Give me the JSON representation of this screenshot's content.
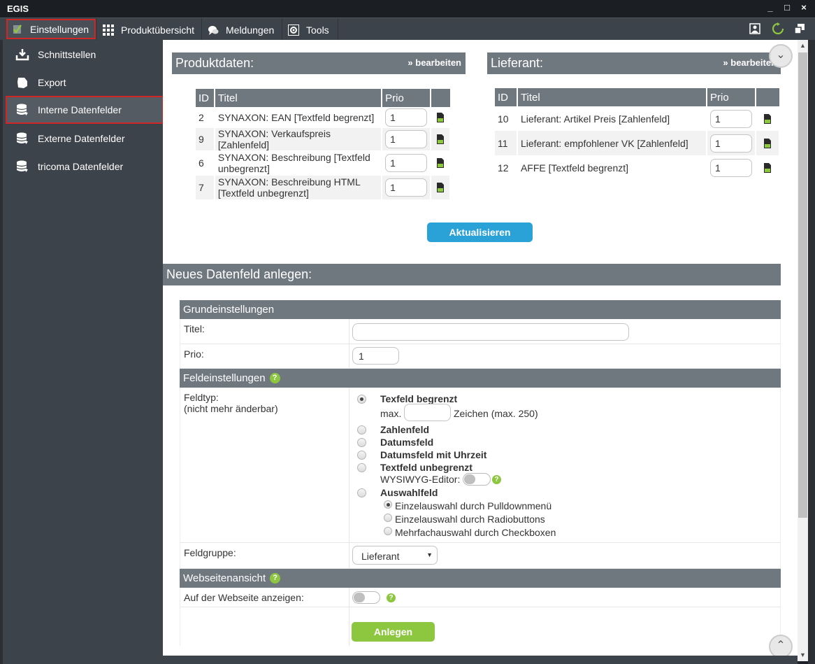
{
  "window": {
    "title": "EGIS"
  },
  "menu": {
    "einstellungen": "Einstellungen",
    "produktuebersicht": "Produktübersicht",
    "meldungen": "Meldungen",
    "tools": "Tools"
  },
  "sidebar": {
    "items": [
      {
        "label": "Schnittstellen"
      },
      {
        "label": "Export"
      },
      {
        "label": "Interne Datenfelder"
      },
      {
        "label": "Externe Datenfelder"
      },
      {
        "label": "tricoma Datenfelder"
      }
    ]
  },
  "produktdaten": {
    "title": "Produktdaten:",
    "edit": "» bearbeiten",
    "headers": {
      "id": "ID",
      "titel": "Titel",
      "prio": "Prio"
    },
    "rows": [
      {
        "id": "2",
        "titel": "SYNAXON: EAN [Textfeld begrenzt]",
        "prio": "1"
      },
      {
        "id": "9",
        "titel": "SYNAXON: Verkaufspreis [Zahlenfeld]",
        "prio": "1"
      },
      {
        "id": "6",
        "titel": "SYNAXON: Beschreibung [Textfeld unbegrenzt]",
        "prio": "1"
      },
      {
        "id": "7",
        "titel": "SYNAXON: Beschreibung HTML [Textfeld unbegrenzt]",
        "prio": "1"
      }
    ]
  },
  "lieferant": {
    "title": "Lieferant:",
    "edit": "» bearbeiten",
    "headers": {
      "id": "ID",
      "titel": "Titel",
      "prio": "Prio"
    },
    "rows": [
      {
        "id": "10",
        "titel": "Lieferant: Artikel Preis [Zahlenfeld]",
        "prio": "1"
      },
      {
        "id": "11",
        "titel": "Lieferant: empfohlener VK [Zahlenfeld]",
        "prio": "1"
      },
      {
        "id": "12",
        "titel": "AFFE [Textfeld begrenzt]",
        "prio": "1"
      }
    ]
  },
  "aktualisieren": "Aktualisieren",
  "neu": {
    "title": "Neues Datenfeld anlegen:",
    "grund": {
      "head": "Grundeinstellungen",
      "titel_label": "Titel:",
      "titel_value": "",
      "prio_label": "Prio:",
      "prio_value": "1"
    },
    "feld": {
      "head": "Feldeinstellungen",
      "help": "?",
      "feldtyp_label": "Feldtyp:",
      "feldtyp_sub": "(nicht mehr änderbar)",
      "options": {
        "texfeld": "Texfeld begrenzt",
        "max_label": "max.",
        "max_value": "",
        "zeichen": "Zeichen (max. 250)",
        "zahlenfeld": "Zahlenfeld",
        "datumsfeld": "Datumsfeld",
        "datumsfeld_uhrzeit": "Datumsfeld mit Uhrzeit",
        "textfeld_unbegrenzt": "Textfeld unbegrenzt",
        "wysiwyg": "WYSIWYG-Editor:",
        "auswahlfeld": "Auswahlfeld",
        "einzel_pull": "Einzelauswahl durch Pulldownmenü",
        "einzel_radio": "Einzelauswahl durch Radiobuttons",
        "mehrfach": "Mehrfachauswahl durch Checkboxen"
      },
      "selected_type": "Texfeld begrenzt",
      "selected_sub": "Einzelauswahl durch Pulldownmenü",
      "wysiwyg_on": false,
      "feldgruppe_label": "Feldgruppe:",
      "feldgruppe_value": "Lieferant"
    },
    "web": {
      "head": "Webseitenansicht",
      "help": "?",
      "anzeigen_label": "Auf der Webseite anzeigen:",
      "anzeigen_on": false
    },
    "anlegen": "Anlegen"
  },
  "icons": {
    "check": "check-icon",
    "grid": "grid-icon",
    "chat": "chat-icon",
    "tools": "tools-icon",
    "user": "user-icon",
    "refresh": "refresh-icon",
    "window": "window-icon",
    "download": "download-icon",
    "export": "export-icon",
    "database": "database-icon",
    "doc": "document-icon",
    "chevron_down": "chevron-down-icon",
    "chevron_up": "chevron-up-icon"
  },
  "colors": {
    "accent_blue": "#2aa2d8",
    "accent_green": "#8dc63f",
    "header_gray": "#6f777f",
    "sidebar": "#3d434a",
    "highlight_red": "#d02626"
  }
}
